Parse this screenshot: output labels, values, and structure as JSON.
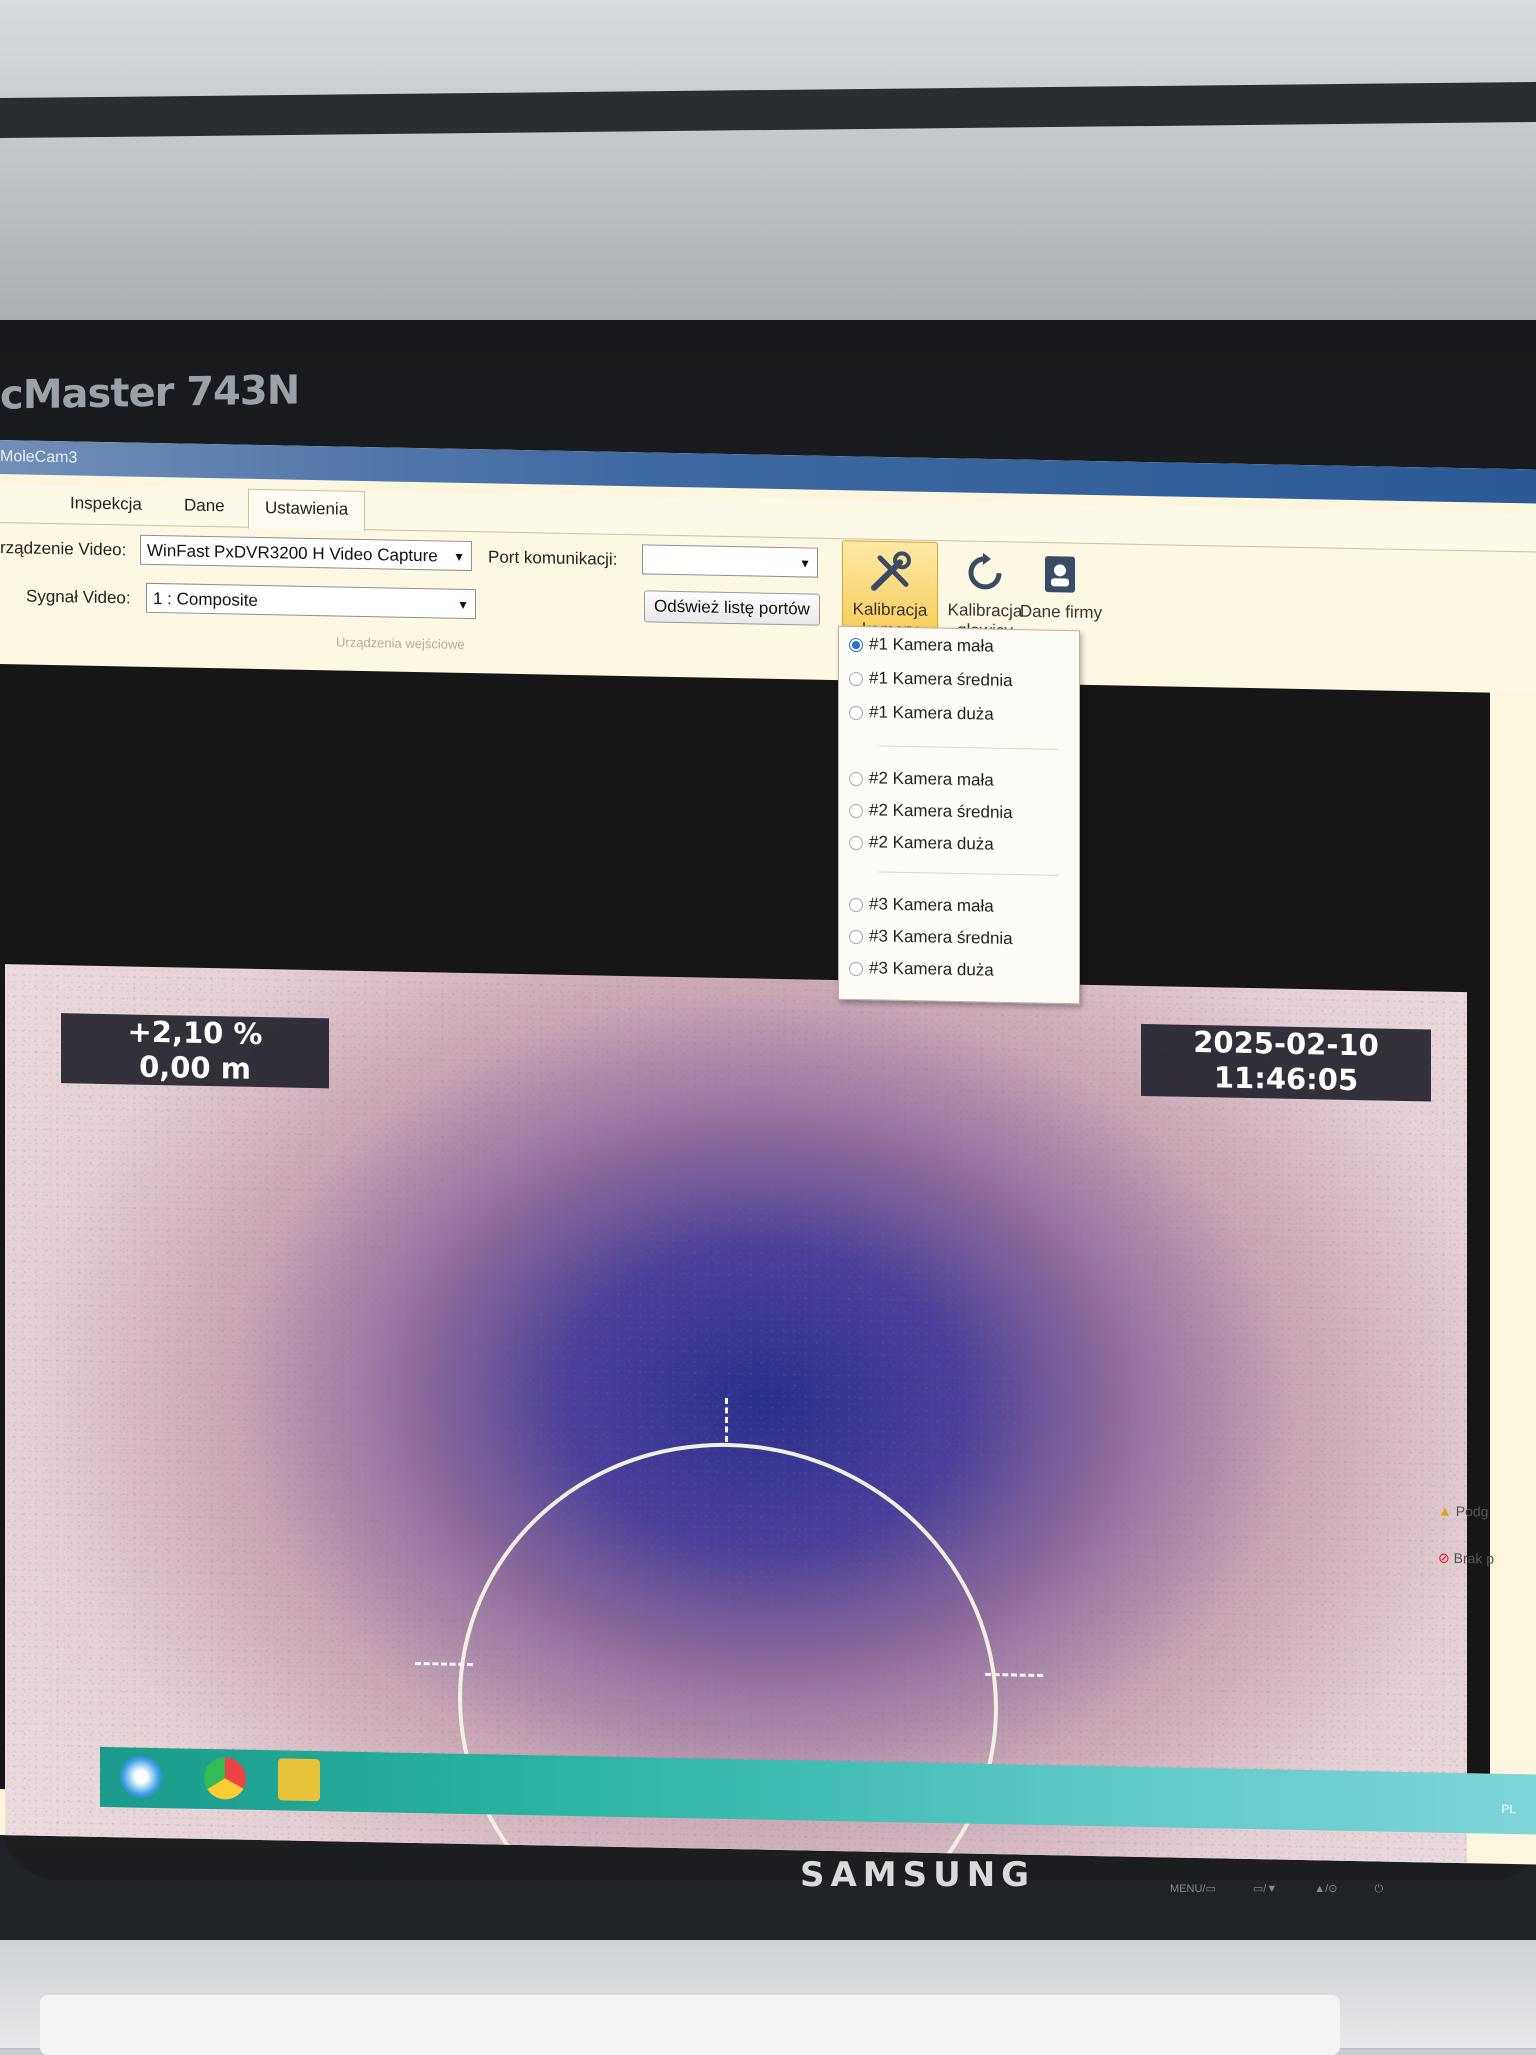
{
  "monitor": {
    "model_partial": "cMaster 743N",
    "brand": "SAMSUNG",
    "button_labels": "MENU/▭ ▭/▼ ▲/⊙ ⏻"
  },
  "window": {
    "title": "MoleCam3"
  },
  "tabs": [
    "Inspekcja",
    "Dane",
    "Ustawienia"
  ],
  "ribbon": {
    "video_device_label": "rządzenie Video:",
    "video_device_value": "WinFast PxDVR3200 H Video Capture",
    "video_signal_label": "Sygnał Video:",
    "video_signal_value": "1 : Composite",
    "port_label": "Port komunikacji:",
    "port_value": "",
    "refresh_ports": "Odśwież listę portów",
    "group_caption": "Urządzenia wejściowe",
    "camera_calibration": "Kalibracja kamery",
    "head_calibration": "Kalibracja głowicy",
    "company_data": "Dane firmy"
  },
  "camera_menu": {
    "items": [
      {
        "label": "#1 Kamera mała",
        "selected": true
      },
      {
        "label": "#1 Kamera średnia",
        "selected": false
      },
      {
        "label": "#1 Kamera duża",
        "selected": false
      },
      {
        "label": "#2 Kamera mała",
        "selected": false
      },
      {
        "label": "#2 Kamera średnia",
        "selected": false
      },
      {
        "label": "#2 Kamera duża",
        "selected": false
      },
      {
        "label": "#3 Kamera mała",
        "selected": false
      },
      {
        "label": "#3 Kamera średnia",
        "selected": false
      },
      {
        "label": "#3 Kamera duża",
        "selected": false
      }
    ]
  },
  "video_overlay": {
    "incline": "+2,10 %",
    "distance": "0,00 m",
    "date": "2025-02-10",
    "time": "11:46:05"
  },
  "side_panel": {
    "item1": "Podg",
    "item2": "Brak p"
  },
  "taskbar": {
    "tray_lang": "PL"
  }
}
